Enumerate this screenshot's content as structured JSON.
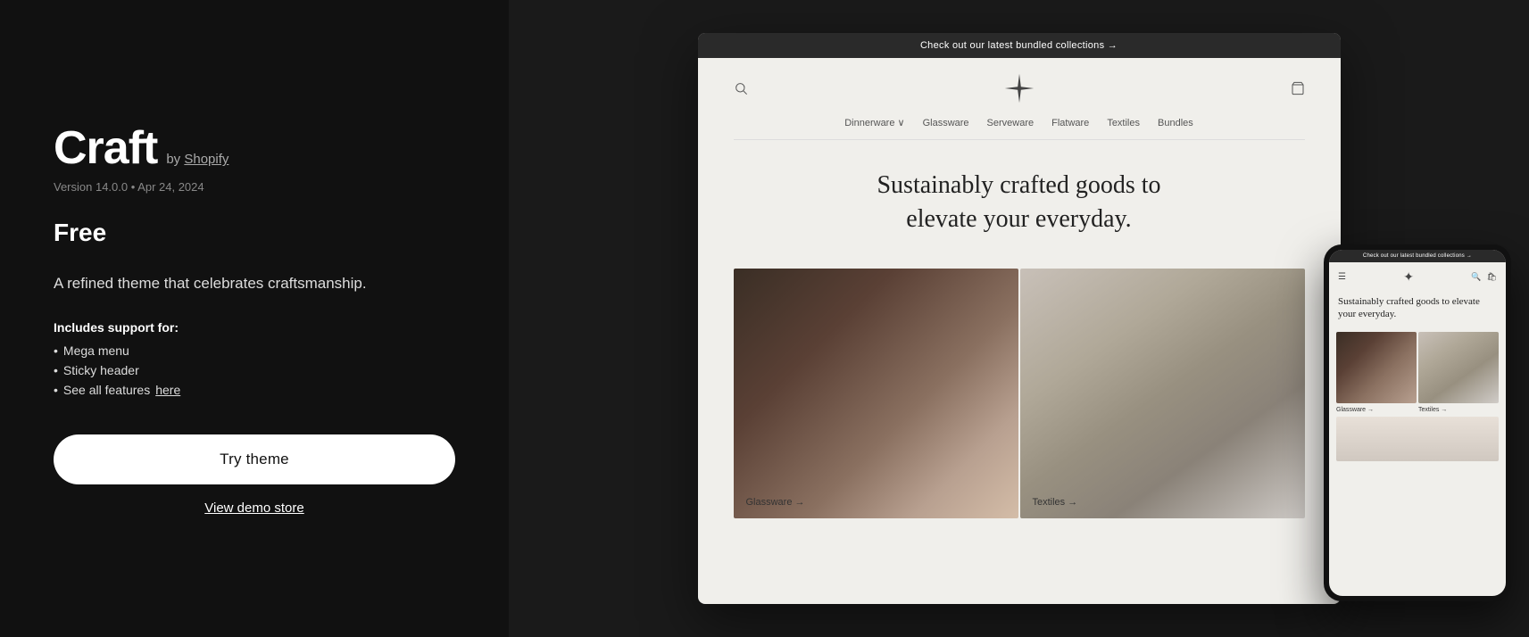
{
  "left": {
    "title": "Craft",
    "by_label": "by",
    "shopify_label": "Shopify",
    "version": "Version 14.0.0 • Apr 24, 2024",
    "price": "Free",
    "description": "A refined theme that celebrates craftsmanship.",
    "includes_title": "Includes support for:",
    "features": [
      {
        "text": "Mega menu"
      },
      {
        "text": "Sticky header"
      },
      {
        "text": "See all features ",
        "link_text": "here"
      }
    ],
    "try_theme_label": "Try theme",
    "view_demo_label": "View demo store"
  },
  "desktop_preview": {
    "announcement": "Check out our latest bundled collections →",
    "nav_items": [
      "Dinnerware ∨",
      "Glassware",
      "Serveware",
      "Flatware",
      "Textiles",
      "Bundles"
    ],
    "hero_headline": "Sustainably crafted goods to elevate your everyday.",
    "product_cards": [
      {
        "label": "Glassware →"
      },
      {
        "label": "Textiles →"
      }
    ]
  },
  "mobile_preview": {
    "announcement": "Check out our latest bundled collections →",
    "hero_text": "Sustainably crafted goods to elevate your everyday.",
    "product_labels": [
      "Glassware →",
      "Textiles →"
    ]
  }
}
